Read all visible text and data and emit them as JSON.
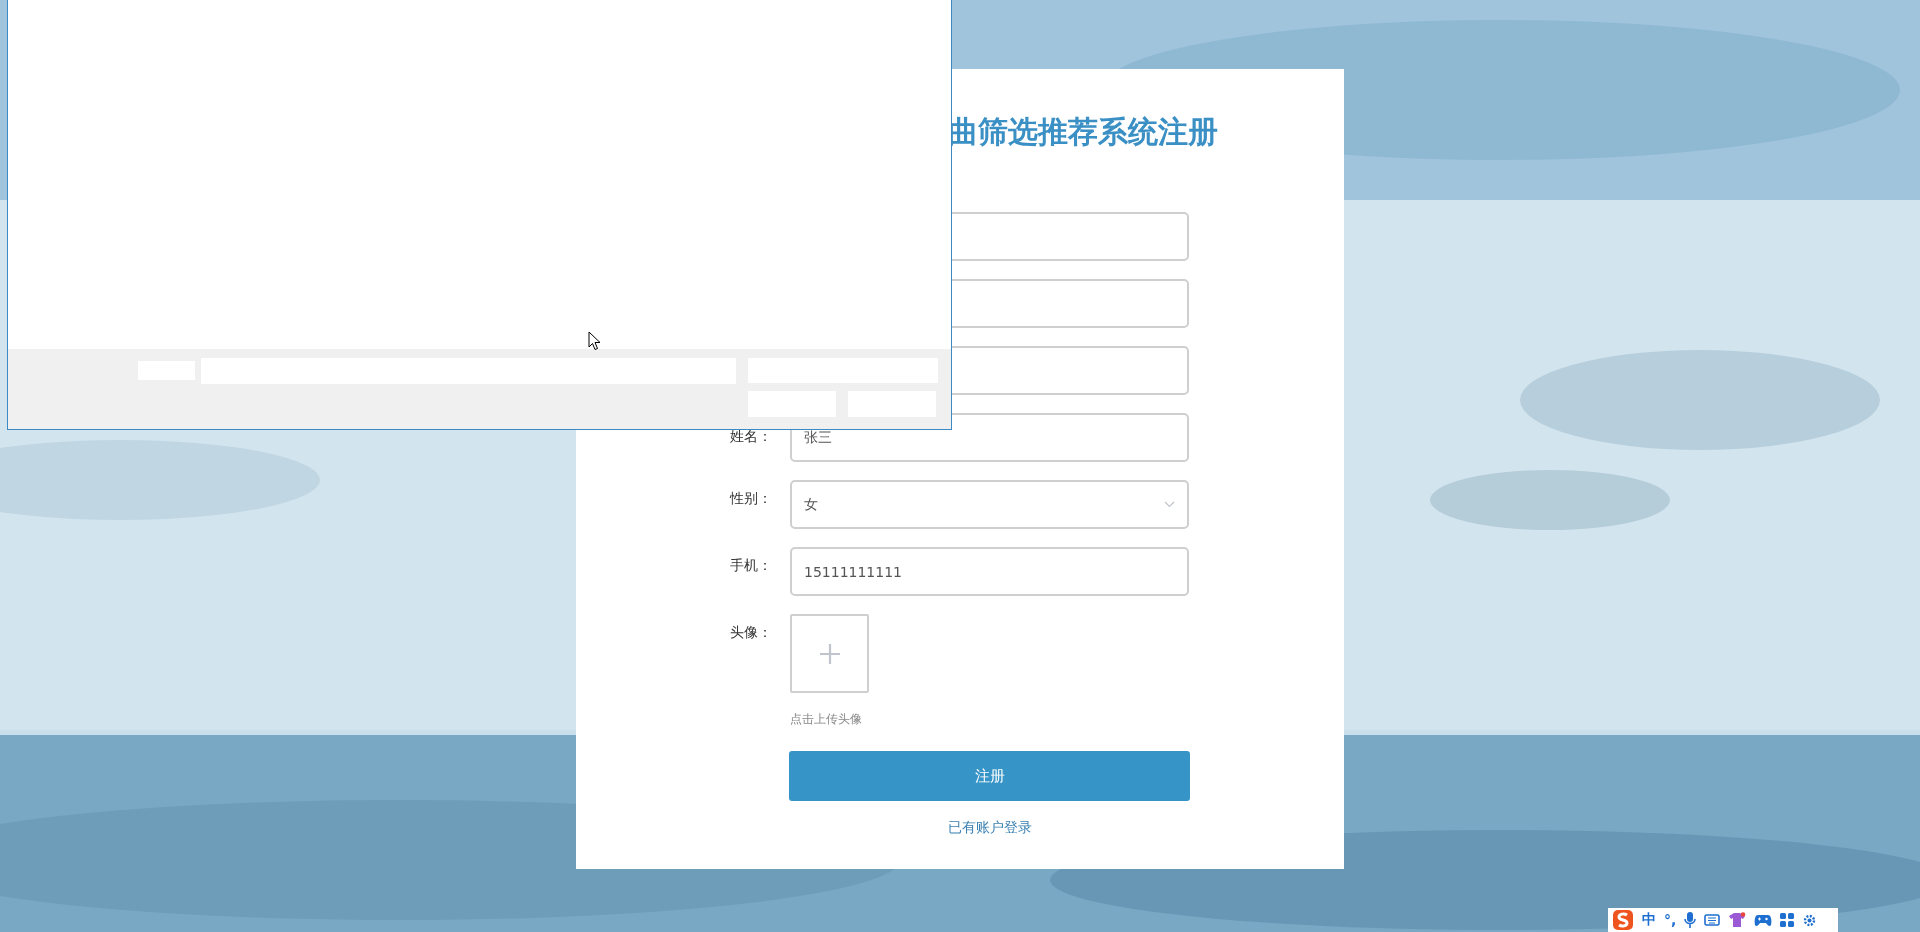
{
  "title": "曲筛选推荐系统注册",
  "fields": [
    {
      "kind": "input"
    },
    {
      "kind": "input"
    },
    {
      "kind": "input"
    },
    {
      "kind": "input",
      "label": "姓名：",
      "value": "张三"
    },
    {
      "kind": "select",
      "label": "性别：",
      "value": "女"
    },
    {
      "kind": "input",
      "label": "手机：",
      "value": "15111111111"
    },
    {
      "kind": "upload",
      "label": "头像：",
      "hint": "点击上传头像"
    }
  ],
  "submit": "注册",
  "login_link": "已有账户登录",
  "ime": {
    "mode": "中",
    "punct": "°,"
  }
}
